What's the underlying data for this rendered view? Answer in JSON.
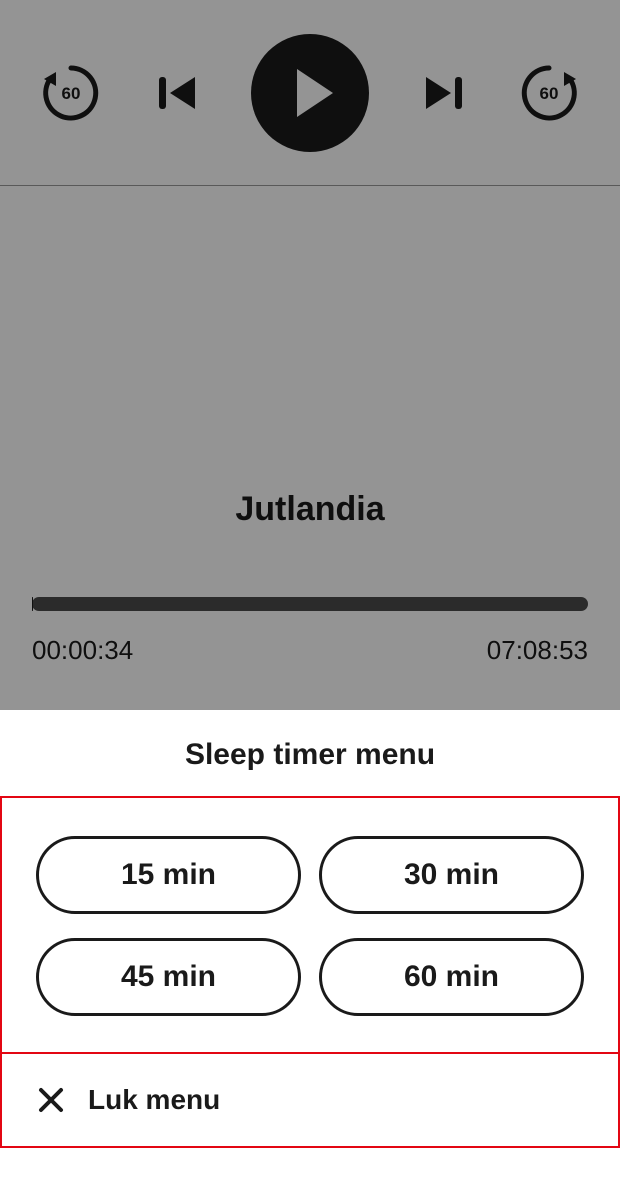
{
  "player": {
    "rewind_seconds": "60",
    "forward_seconds": "60",
    "track_title": "Jutlandia",
    "elapsed": "00:00:34",
    "total": "07:08:53"
  },
  "sheet": {
    "title": "Sleep timer menu",
    "options": [
      "15 min",
      "30 min",
      "45 min",
      "60 min"
    ],
    "close_label": "Luk menu"
  }
}
